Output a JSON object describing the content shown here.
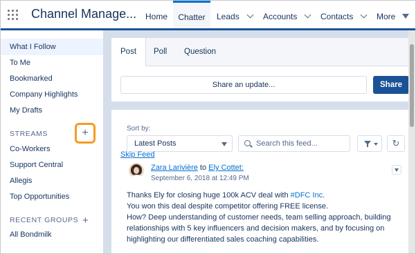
{
  "app": {
    "name": "Channel Manage..."
  },
  "nav": {
    "home": "Home",
    "chatter": "Chatter",
    "leads": "Leads",
    "accounts": "Accounts",
    "contacts": "Contacts",
    "more": "More"
  },
  "sidebar": {
    "items": [
      "What I Follow",
      "To Me",
      "Bookmarked",
      "Company Highlights",
      "My Drafts"
    ],
    "streams_header": "STREAMS",
    "streams": [
      "Co-Workers",
      "Support Central",
      "Allegis",
      "Top Opportunities"
    ],
    "groups_header": "RECENT GROUPS",
    "groups": [
      "All Bondmilk"
    ],
    "add_symbol": "+"
  },
  "publisher": {
    "tabs": [
      "Post",
      "Poll",
      "Question"
    ],
    "placeholder": "Share an update...",
    "share_label": "Share"
  },
  "feed": {
    "sort_label": "Sort by:",
    "sort_value": "Latest Posts",
    "search_placeholder": "Search this feed...",
    "skip_link": "Skip Feed",
    "post": {
      "author": "Zara Larivière",
      "to": "to",
      "recipient": "Ely Cottet:",
      "date": "September 6, 2018 at 12:49 PM",
      "line1_a": "Thanks Ely for closing huge 100k ACV deal with ",
      "line1_tag": "#DFC Inc",
      "line1_b": ".",
      "line2": "You won this deal despite competitor offering FREE license.",
      "line3": "How? Deep understanding of customer needs, team selling approach, building",
      "line4": "relationships with 5 key influencers and decision makers, and by focusing on",
      "line5": "highlighting our differentiated sales coaching capabilities."
    }
  },
  "colors": {
    "brand": "#1b5297",
    "link": "#0070d2",
    "highlight": "#f59b22"
  }
}
